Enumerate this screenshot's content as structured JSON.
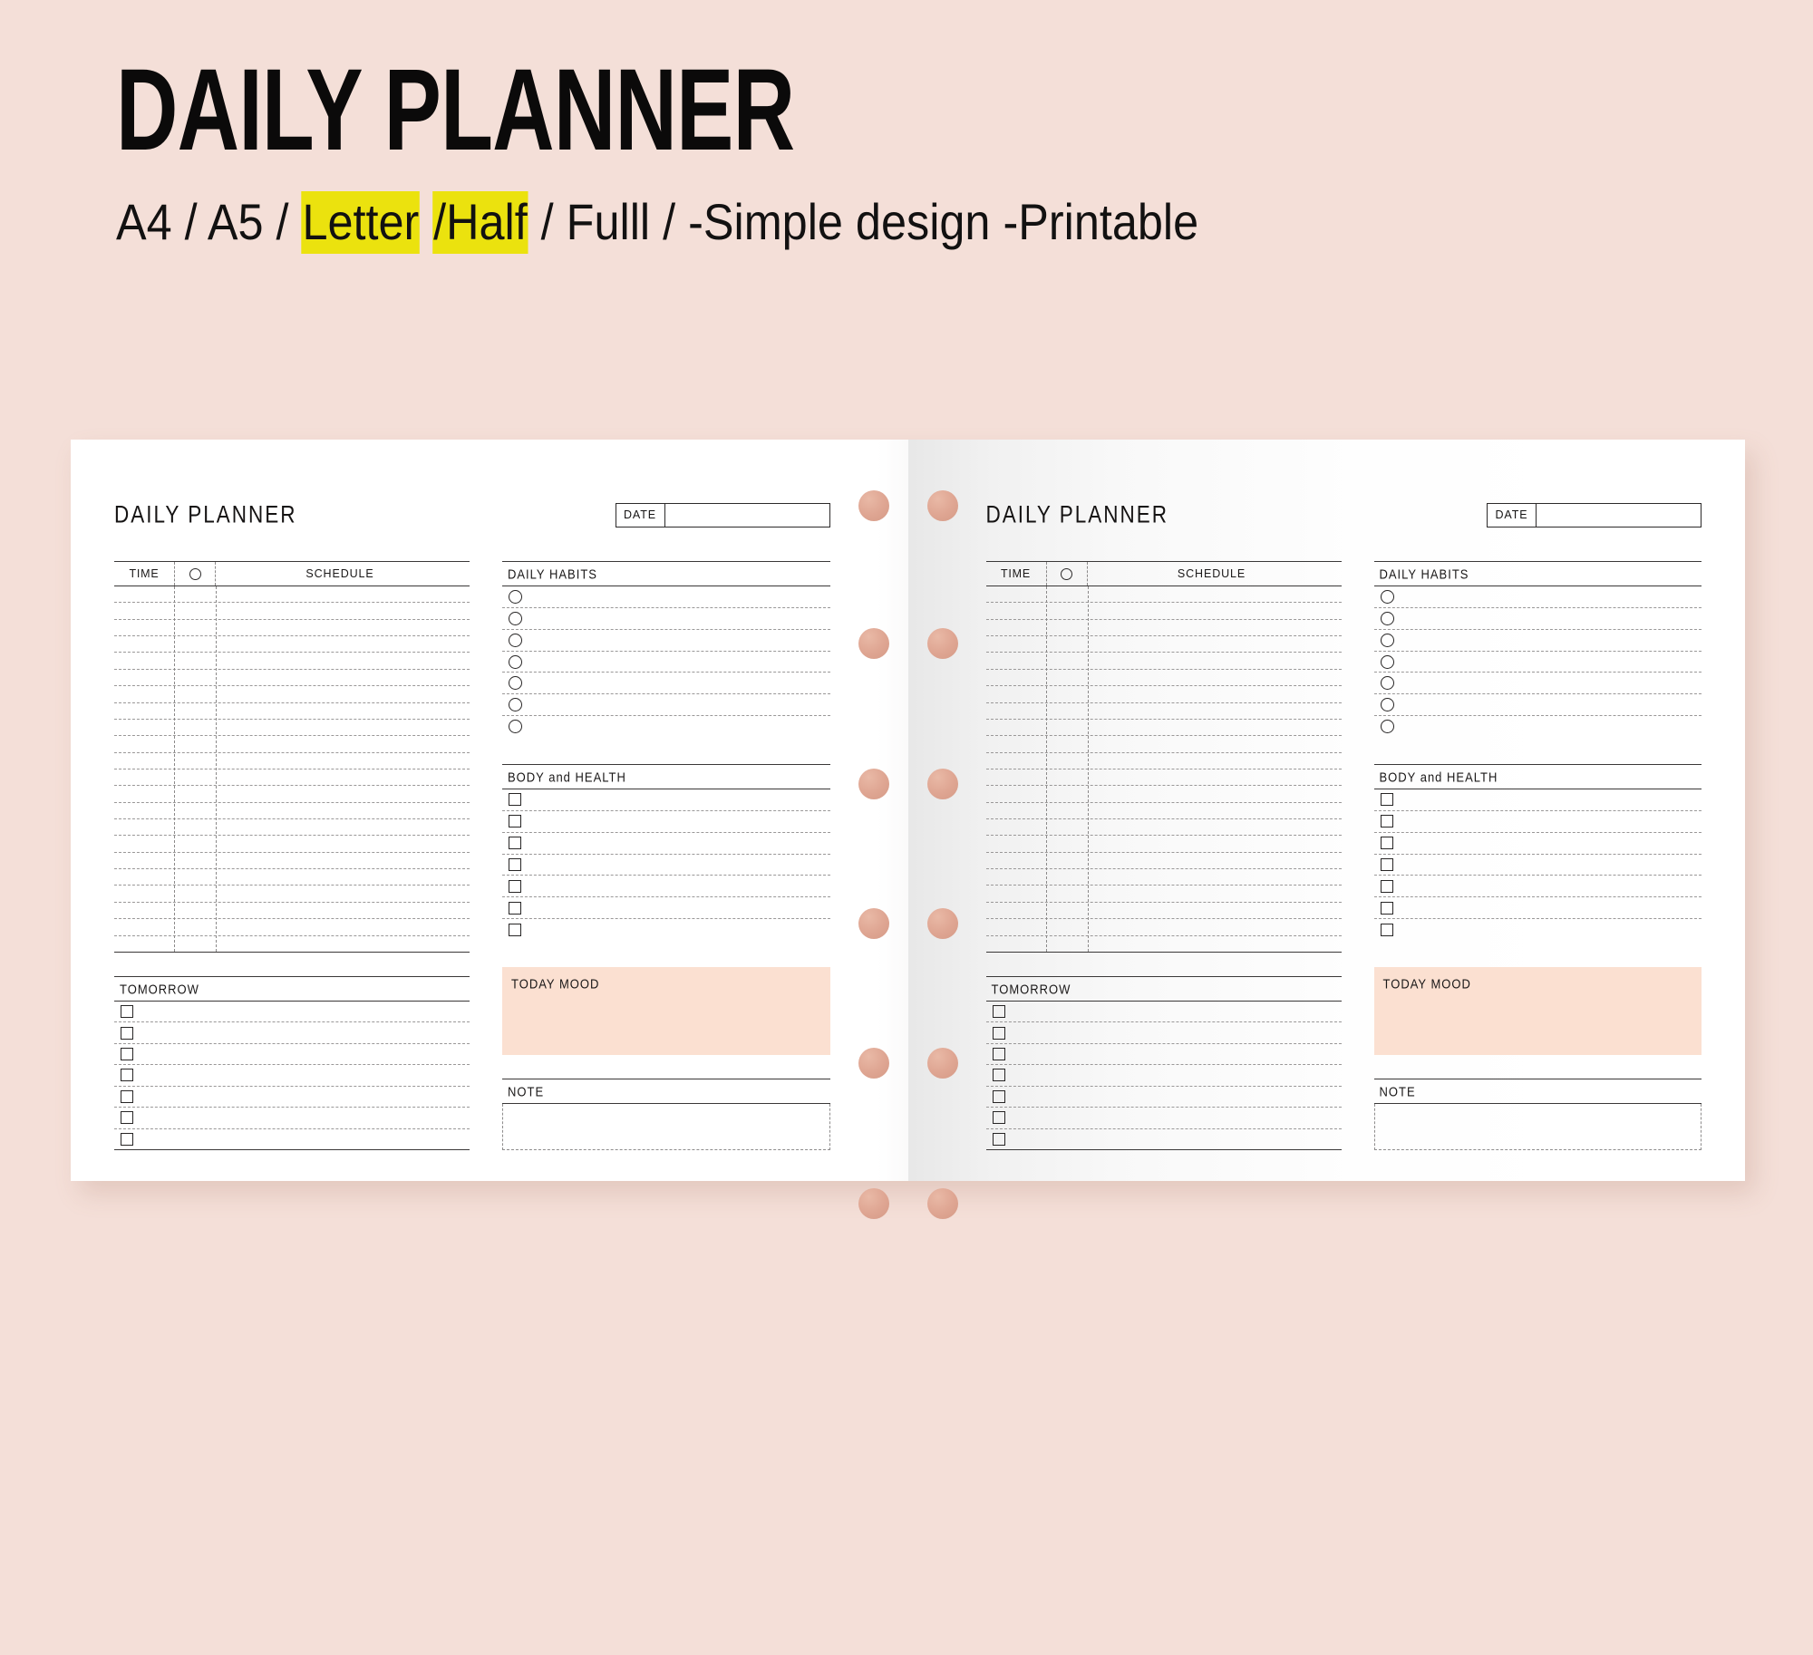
{
  "header": {
    "title": "DAILY PLANNER",
    "subtitle_parts": [
      {
        "text": "A4 / A5 / ",
        "highlight": false
      },
      {
        "text": "Letter",
        "highlight": true
      },
      {
        "text": " ",
        "highlight": false
      },
      {
        "text": "/Half",
        "highlight": true
      },
      {
        "text": " / Fulll / -Simple design -Printable",
        "highlight": false
      }
    ],
    "highlight_color": "#EBE20E"
  },
  "page": {
    "title": "DAILY PLANNER",
    "date_label": "DATE",
    "date_value": "",
    "schedule": {
      "col_time": "TIME",
      "col_mark_icon": "circle-icon",
      "col_schedule": "SCHEDULE",
      "row_count": 22
    },
    "daily_habits": {
      "title": "DAILY HABITS",
      "bullet": "circle",
      "row_count": 7,
      "items": [
        "",
        "",
        "",
        "",
        "",
        "",
        ""
      ]
    },
    "body_health": {
      "title": "BODY and HEALTH",
      "bullet": "square",
      "row_count": 7,
      "items": [
        "",
        "",
        "",
        "",
        "",
        "",
        ""
      ]
    },
    "today_mood": {
      "title": "TODAY MOOD",
      "value": "",
      "background": "#FBE0D1"
    },
    "tomorrow": {
      "title": "TOMORROW",
      "bullet": "square",
      "row_count": 7,
      "items": [
        "",
        "",
        "",
        "",
        "",
        "",
        ""
      ]
    },
    "note": {
      "title": "NOTE",
      "value": ""
    }
  },
  "spread": {
    "ring_dot_color": "#DFA693",
    "ring_dot_count_per_page": 6,
    "background_color": "#F4DFD8",
    "page_color": "#FFFFFF"
  }
}
